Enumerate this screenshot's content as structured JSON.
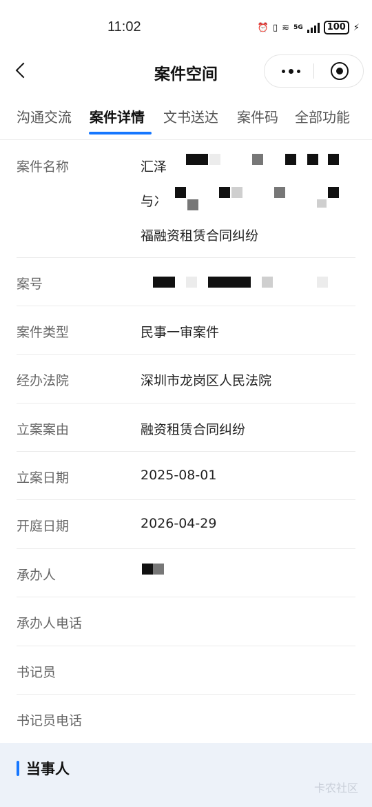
{
  "status": {
    "time": "11:02",
    "battery": "100",
    "network": "5G"
  },
  "nav": {
    "title": "案件空间"
  },
  "tabs": [
    {
      "label": "沟通交流"
    },
    {
      "label": "案件详情"
    },
    {
      "label": "文书送达"
    },
    {
      "label": "案件码"
    },
    {
      "label": "全部功能"
    }
  ],
  "details": {
    "case_name_label": "案件名称",
    "case_name_line1": "汇泽",
    "case_name_line2": "与冫",
    "case_name_line3": "福融资租赁合同纠纷",
    "case_no_label": "案号",
    "case_type_label": "案件类型",
    "case_type": "民事一审案件",
    "court_label": "经办法院",
    "court": "深圳市龙岗区人民法院",
    "cause_label": "立案案由",
    "cause": "融资租赁合同纠纷",
    "filing_date_label": "立案日期",
    "filing_date": "2025-08-01",
    "hearing_date_label": "开庭日期",
    "hearing_date": "2026-04-29",
    "judge_label": "承办人",
    "judge_phone_label": "承办人电话",
    "clerk_label": "书记员",
    "clerk_phone_label": "书记员电话"
  },
  "section": {
    "title": "当事人",
    "watermark": "卡农社区"
  },
  "colors": {
    "accent": "#1677ff",
    "section_bg": "#edf2f9"
  }
}
